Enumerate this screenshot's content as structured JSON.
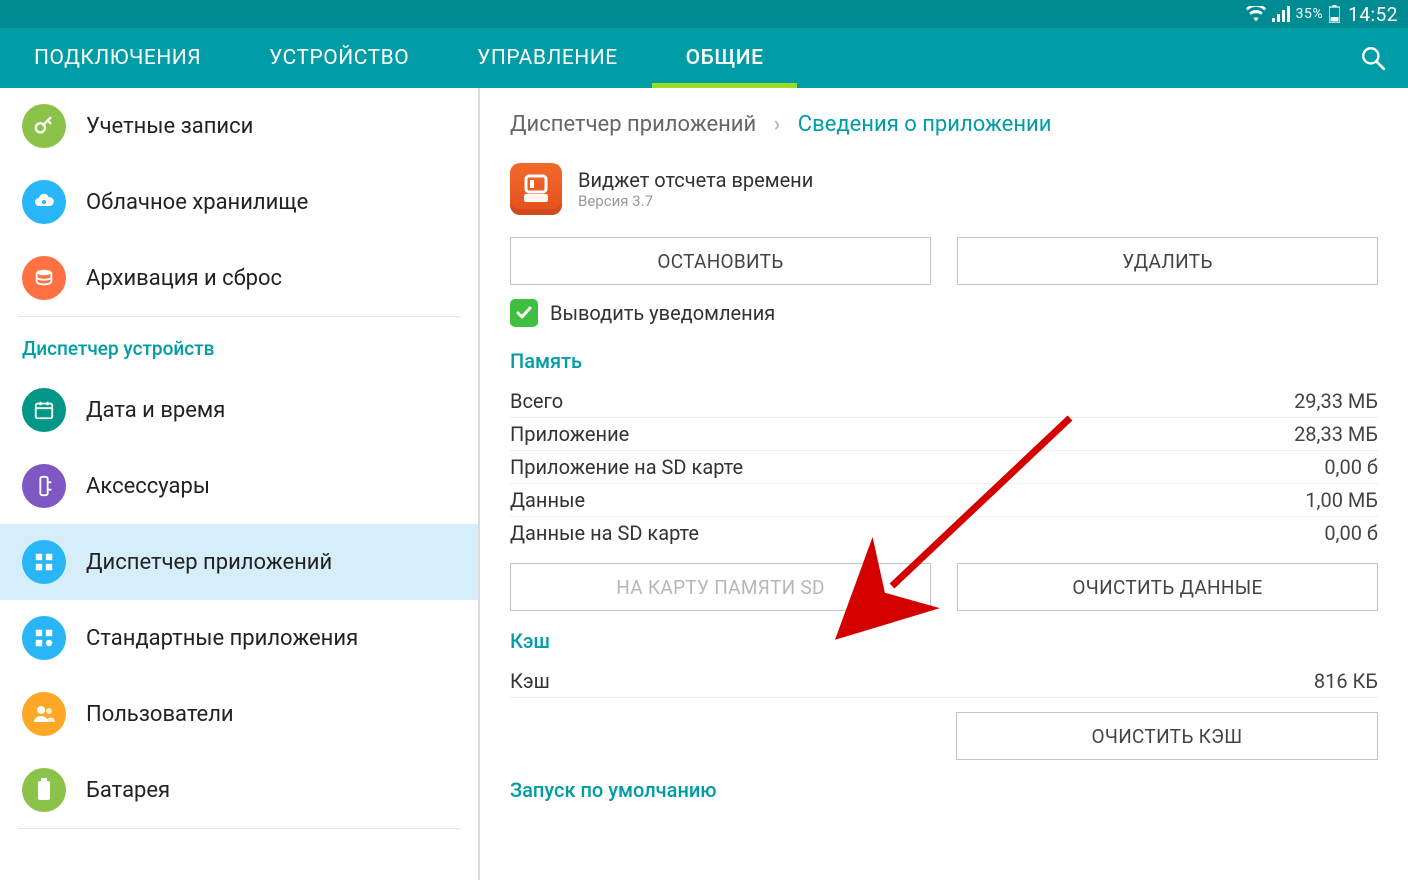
{
  "status": {
    "battery_pct": "35%",
    "time": "14:52"
  },
  "tabs": [
    {
      "label": "ПОДКЛЮЧЕНИЯ",
      "active": false
    },
    {
      "label": "УСТРОЙСТВО",
      "active": false
    },
    {
      "label": "УПРАВЛЕНИЕ",
      "active": false
    },
    {
      "label": "ОБЩИЕ",
      "active": true
    }
  ],
  "sidebar": {
    "items_top": [
      {
        "id": "accounts",
        "label": "Учетные записи",
        "icon": "key-icon",
        "color": "#8bc34a"
      },
      {
        "id": "cloud",
        "label": "Облачное хранилище",
        "icon": "cloud-icon",
        "color": "#29b6f6"
      },
      {
        "id": "backup",
        "label": "Архивация и сброс",
        "icon": "backup-icon",
        "color": "#ff7043"
      }
    ],
    "section_header": "Диспетчер устройств",
    "items_mid": [
      {
        "id": "date",
        "label": "Дата и время",
        "icon": "calendar-icon",
        "color": "#009688"
      },
      {
        "id": "accessories",
        "label": "Аксессуары",
        "icon": "accessory-icon",
        "color": "#7e57c2"
      },
      {
        "id": "app-manager",
        "label": "Диспетчер приложений",
        "icon": "grid-icon",
        "color": "#29b6f6",
        "selected": true
      },
      {
        "id": "default-apps",
        "label": "Стандартные приложения",
        "icon": "grid-dot-icon",
        "color": "#29b6f6"
      },
      {
        "id": "users",
        "label": "Пользователи",
        "icon": "users-icon",
        "color": "#ffa726"
      },
      {
        "id": "battery",
        "label": "Батарея",
        "icon": "battery-icon",
        "color": "#8bc34a"
      }
    ]
  },
  "breadcrumb": {
    "parent": "Диспетчер приложений",
    "current": "Сведения о приложении"
  },
  "app": {
    "name": "Виджет отсчета времени",
    "version": "Версия 3.7"
  },
  "buttons": {
    "stop": "ОСТАНОВИТЬ",
    "delete": "УДАЛИТЬ",
    "move_sd": "НА КАРТУ ПАМЯТИ SD",
    "clear_data": "ОЧИСТИТЬ ДАННЫЕ",
    "clear_cache": "ОЧИСТИТЬ КЭШ"
  },
  "checkbox": {
    "label": "Выводить уведомления",
    "checked": true
  },
  "sections": {
    "memory_header": "Память",
    "memory": [
      {
        "k": "Всего",
        "v": "29,33 МБ"
      },
      {
        "k": "Приложение",
        "v": "28,33 МБ"
      },
      {
        "k": "Приложение на SD карте",
        "v": "0,00 б"
      },
      {
        "k": "Данные",
        "v": "1,00 МБ"
      },
      {
        "k": "Данные на SD карте",
        "v": "0,00 б"
      }
    ],
    "cache_header": "Кэш",
    "cache": [
      {
        "k": "Кэш",
        "v": "816 КБ"
      }
    ],
    "launch_header": "Запуск по умолчанию"
  }
}
